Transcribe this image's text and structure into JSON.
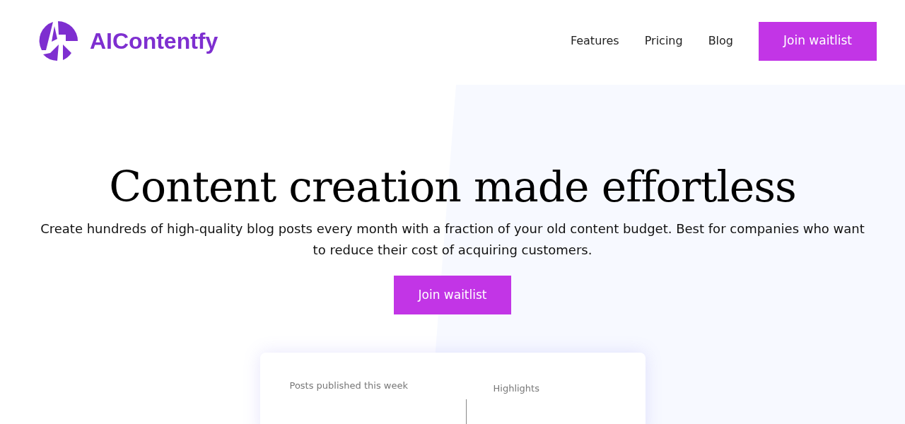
{
  "brand": {
    "name": "AIContentfy"
  },
  "nav": {
    "links": [
      {
        "label": "Features"
      },
      {
        "label": "Pricing"
      },
      {
        "label": "Blog"
      }
    ],
    "cta": "Join waitlist"
  },
  "hero": {
    "title": "Content creation made effortless",
    "subtitle": "Create hundreds of high-quality blog posts every month with a fraction of your old content budget. Best for companies who want to reduce their cost of acquiring customers.",
    "cta": "Join waitlist"
  },
  "dashboard": {
    "left_label": "Posts published this week",
    "right_label": "Highlights"
  }
}
